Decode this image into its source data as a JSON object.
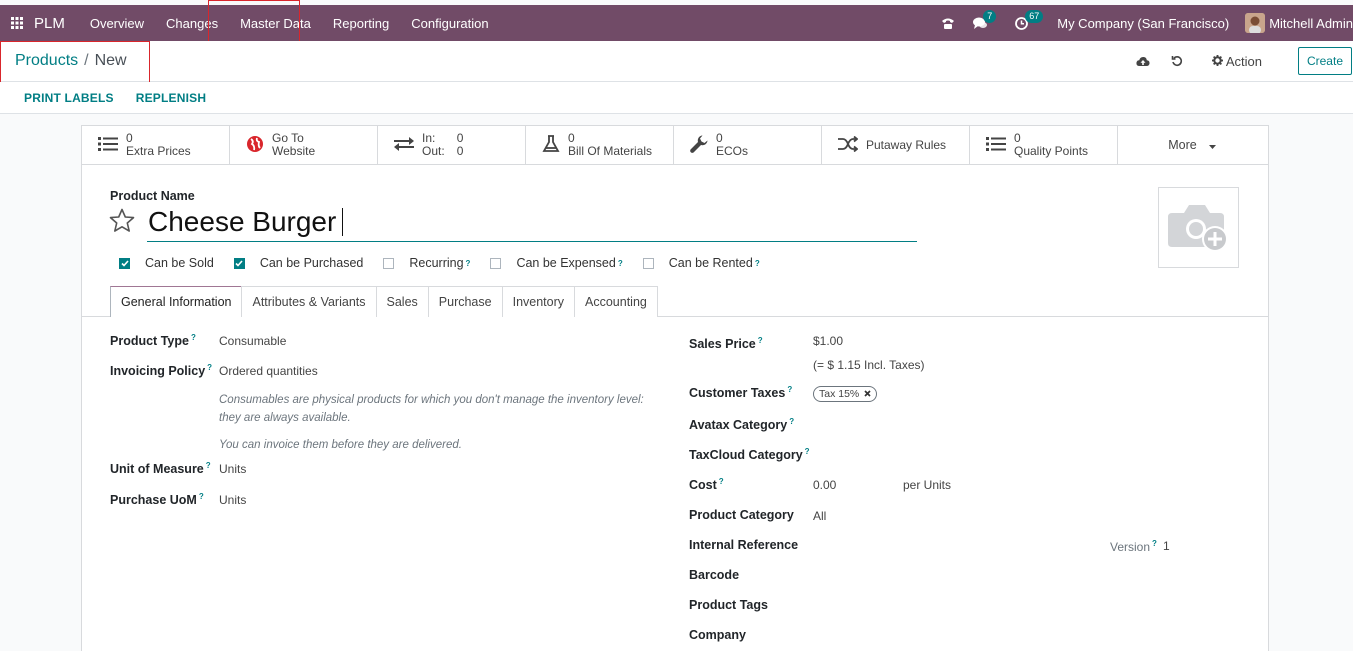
{
  "topbar": {
    "app_name": "PLM",
    "menu": [
      "Overview",
      "Changes",
      "Master Data",
      "Reporting",
      "Configuration"
    ],
    "messages_badge": "7",
    "activity_badge": "67",
    "company": "My Company (San Francisco)",
    "user": "Mitchell Admin"
  },
  "breadcrumb": {
    "parent": "Products",
    "separator": "/",
    "current": "New"
  },
  "control": {
    "action_label": "Action",
    "create_label": "Create"
  },
  "subbar": {
    "print_labels": "PRINT LABELS",
    "replenish": "REPLENISH"
  },
  "smart_buttons": {
    "extra_prices": {
      "count": "0",
      "label": "Extra Prices"
    },
    "website": {
      "line1": "Go To",
      "line2": "Website"
    },
    "inout": {
      "in_label": "In:",
      "in_value": "0",
      "out_label": "Out:",
      "out_value": "0"
    },
    "bom": {
      "count": "0",
      "label": "Bill Of Materials"
    },
    "ecos": {
      "count": "0",
      "label": "ECOs"
    },
    "putaway": {
      "label": "Putaway Rules"
    },
    "quality": {
      "count": "0",
      "label": "Quality Points"
    },
    "more": {
      "label": "More"
    }
  },
  "product": {
    "name_label": "Product Name",
    "name": "Cheese Burger",
    "checkboxes": [
      {
        "label": "Can be Sold",
        "checked": true,
        "help": false
      },
      {
        "label": "Can be Purchased",
        "checked": true,
        "help": false
      },
      {
        "label": "Recurring",
        "checked": false,
        "help": true
      },
      {
        "label": "Can be Expensed",
        "checked": false,
        "help": true
      },
      {
        "label": "Can be Rented",
        "checked": false,
        "help": true
      }
    ]
  },
  "tabs": [
    "General Information",
    "Attributes & Variants",
    "Sales",
    "Purchase",
    "Inventory",
    "Accounting"
  ],
  "help_mark": "?",
  "left_fields": {
    "product_type": {
      "label": "Product Type",
      "value": "Consumable"
    },
    "invoicing_policy": {
      "label": "Invoicing Policy",
      "value": "Ordered quantities"
    },
    "help1a": "Consumables are physical products for which you don't manage the inventory level:",
    "help1b": "they are always available.",
    "help2": "You can invoice them before they are delivered.",
    "uom": {
      "label": "Unit of Measure",
      "value": "Units"
    },
    "purchase_uom": {
      "label": "Purchase UoM",
      "value": "Units"
    }
  },
  "right_fields": {
    "sales_price": {
      "label": "Sales Price",
      "value": "$1.00",
      "incl": "(= $ 1.15 Incl. Taxes)"
    },
    "customer_taxes": {
      "label": "Customer Taxes",
      "tag": "Tax 15%"
    },
    "avatax": {
      "label": "Avatax Category"
    },
    "taxcloud": {
      "label": "TaxCloud Category"
    },
    "cost": {
      "label": "Cost",
      "value": "0.00",
      "per": "per Units"
    },
    "product_category": {
      "label": "Product Category",
      "value": "All"
    },
    "internal_reference": {
      "label": "Internal Reference"
    },
    "version": {
      "label": "Version",
      "value": "1"
    },
    "barcode": {
      "label": "Barcode"
    },
    "product_tags": {
      "label": "Product Tags"
    },
    "company": {
      "label": "Company"
    }
  },
  "colors": {
    "brand": "#714b67",
    "accent": "#017e84",
    "highlight": "#d9262c"
  }
}
